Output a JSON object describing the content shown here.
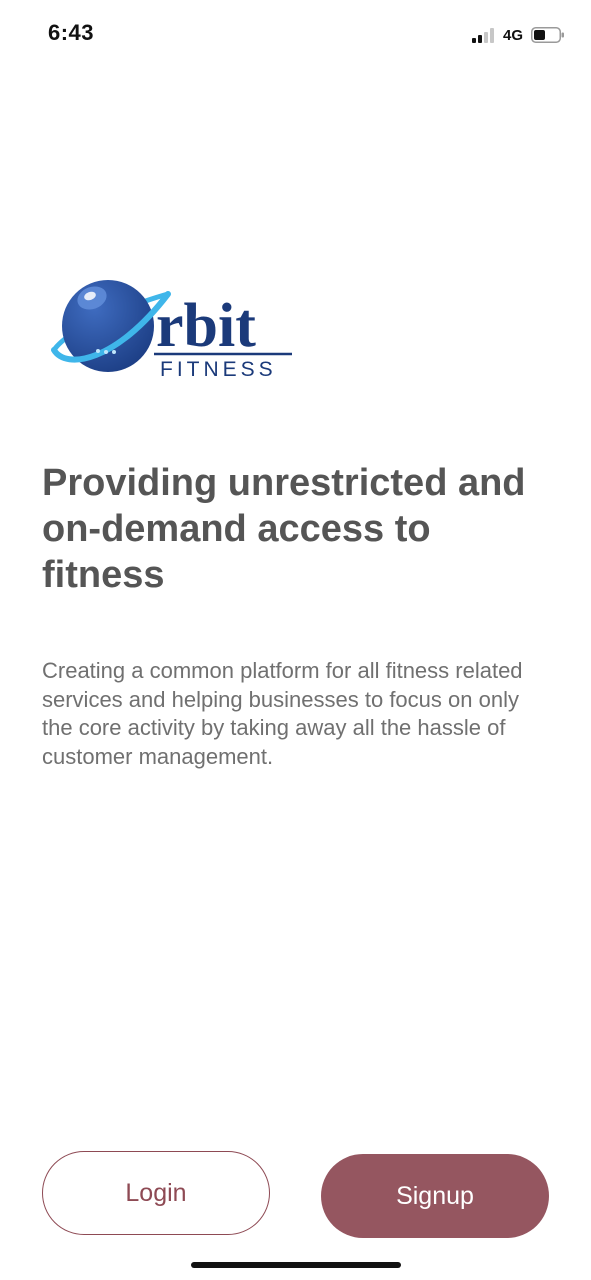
{
  "status_bar": {
    "time": "6:43",
    "network": "4G",
    "signal_icon": "cellular-signal-icon",
    "battery_icon": "battery-icon"
  },
  "logo": {
    "brand_main": "rbit",
    "brand_sub": "FITNESS",
    "colors": {
      "planet": "#2a4f9a",
      "ring": "#3fb6ea",
      "text": "#1b3a7a"
    }
  },
  "hero": {
    "headline": "Providing unrestricted and on-demand access to fitness",
    "description": "Creating a common platform for all fitness related services and helping businesses to focus on only the core activity by taking away all the hassle of customer management."
  },
  "actions": {
    "login_label": "Login",
    "signup_label": "Signup"
  },
  "colors": {
    "accent": "#955660",
    "accent_outline": "#8e4a54",
    "headline_text": "#555555",
    "body_text": "#707070"
  }
}
